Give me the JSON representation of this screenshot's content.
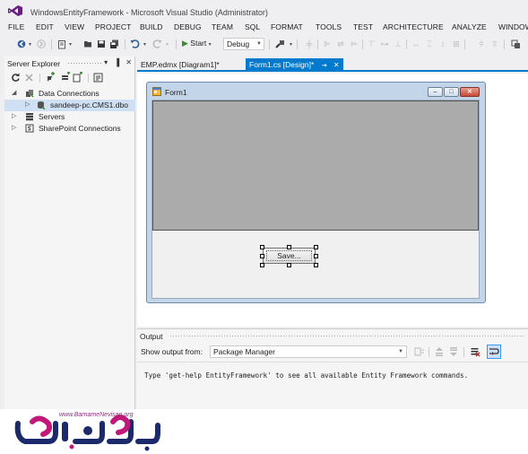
{
  "window": {
    "title": "WindowsEntityFramework - Microsoft Visual Studio (Administrator)"
  },
  "menu": [
    "FILE",
    "EDIT",
    "VIEW",
    "PROJECT",
    "BUILD",
    "DEBUG",
    "TEAM",
    "SQL",
    "FORMAT",
    "TOOLS",
    "TEST",
    "ARCHITECTURE",
    "ANALYZE",
    "WINDOW"
  ],
  "toolbar": {
    "start_label": "Start",
    "config_value": "Debug"
  },
  "server_explorer": {
    "title": "Server Explorer",
    "pin_glyph": "▐",
    "close_glyph": "✕",
    "dropdown_glyph": "▾",
    "tree": [
      {
        "label": "Data Connections",
        "expander": "◢",
        "icon": "data-connections-icon"
      },
      {
        "label": "sandeep-pc.CMS1.dbo",
        "expander": "▷",
        "icon": "database-icon",
        "selected": true
      },
      {
        "label": "Servers",
        "expander": "▷",
        "icon": "servers-icon"
      },
      {
        "label": "SharePoint Connections",
        "expander": "▷",
        "icon": "sharepoint-icon"
      }
    ]
  },
  "tabs": [
    {
      "label": "EMP.edmx [Diagram1]*",
      "active": false
    },
    {
      "label": "Form1.cs [Design]*",
      "active": true,
      "pin": "⇥",
      "close": "✕"
    }
  ],
  "designer": {
    "form_title": "Form1",
    "save_button_label": "Save...",
    "window_buttons": {
      "minimize": "–",
      "maximize": "□",
      "close": "✕"
    }
  },
  "output": {
    "title": "Output",
    "show_output_label": "Show output from:",
    "source_value": "Package Manager",
    "message": "Type 'get-help EntityFramework' to see all available Entity Framework commands."
  },
  "watermark": {
    "url": "www.BarnameNevisan.org"
  },
  "colors": {
    "accent": "#007ACC",
    "ide_background": "#EFEFF2",
    "grid_gray": "#ABABAB",
    "form_frame": "#C3D6E9",
    "watermark_navy": "#1B2A6B",
    "watermark_magenta": "#C2187A"
  }
}
